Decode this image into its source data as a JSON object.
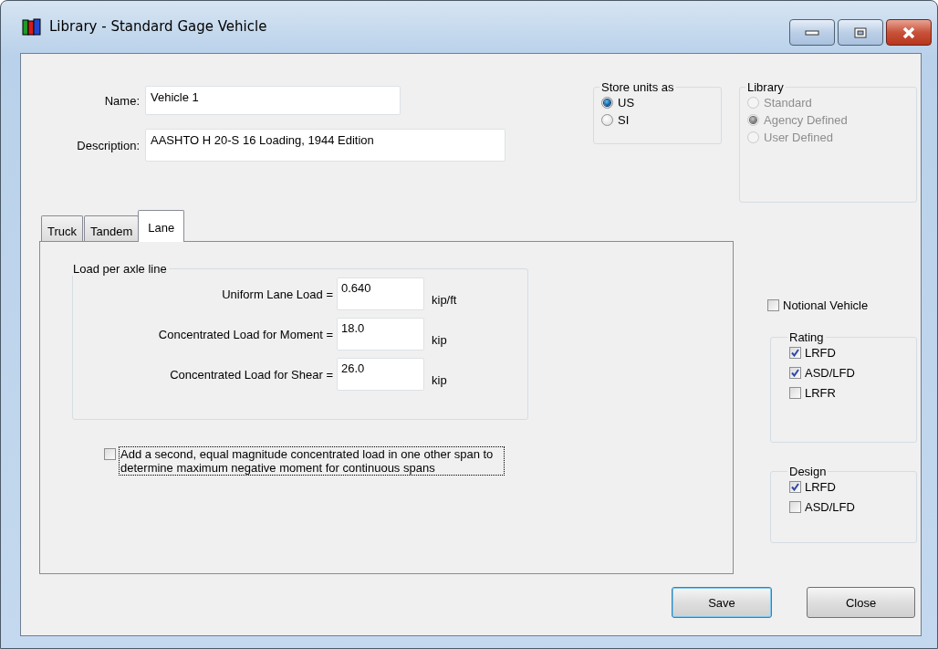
{
  "window": {
    "title": "Library - Standard Gage Vehicle"
  },
  "name": {
    "label": "Name:",
    "value": "Vehicle 1"
  },
  "description": {
    "label": "Description:",
    "value": "AASHTO H 20-S 16 Loading, 1944 Edition"
  },
  "store_units": {
    "title": "Store units as",
    "disabled": false,
    "options": [
      {
        "label": "US",
        "selected": true
      },
      {
        "label": "SI",
        "selected": false
      }
    ]
  },
  "library": {
    "title": "Library",
    "disabled": true,
    "options": [
      {
        "label": "Standard",
        "selected": false
      },
      {
        "label": "Agency Defined",
        "selected": true
      },
      {
        "label": "User Defined",
        "selected": false
      }
    ]
  },
  "tabs": [
    {
      "label": "Truck",
      "selected": false
    },
    {
      "label": "Tandem",
      "selected": false
    },
    {
      "label": "Lane",
      "selected": true
    }
  ],
  "load_group": {
    "title": "Load per axle line",
    "rows": [
      {
        "label": "Uniform Lane Load =",
        "value": "0.640",
        "unit": "kip/ft"
      },
      {
        "label": "Concentrated Load for Moment =",
        "value": "18.0",
        "unit": "kip"
      },
      {
        "label": "Concentrated Load for Shear =",
        "value": "26.0",
        "unit": "kip"
      }
    ]
  },
  "second_load": {
    "label": "Add a second, equal magnitude concentrated load in one other span to determine maximum negative moment for continuous spans",
    "checked": false,
    "focused": true
  },
  "notional_vehicle": {
    "label": "Notional Vehicle",
    "checked": false
  },
  "rating": {
    "title": "Rating",
    "items": [
      {
        "label": "LRFD",
        "checked": true
      },
      {
        "label": "ASD/LFD",
        "checked": true
      },
      {
        "label": "LRFR",
        "checked": false
      }
    ]
  },
  "design": {
    "title": "Design",
    "items": [
      {
        "label": "LRFD",
        "checked": true
      },
      {
        "label": "ASD/LFD",
        "checked": false
      }
    ]
  },
  "buttons": [
    {
      "label": "Save",
      "default": true
    },
    {
      "label": "Close",
      "default": false
    }
  ]
}
